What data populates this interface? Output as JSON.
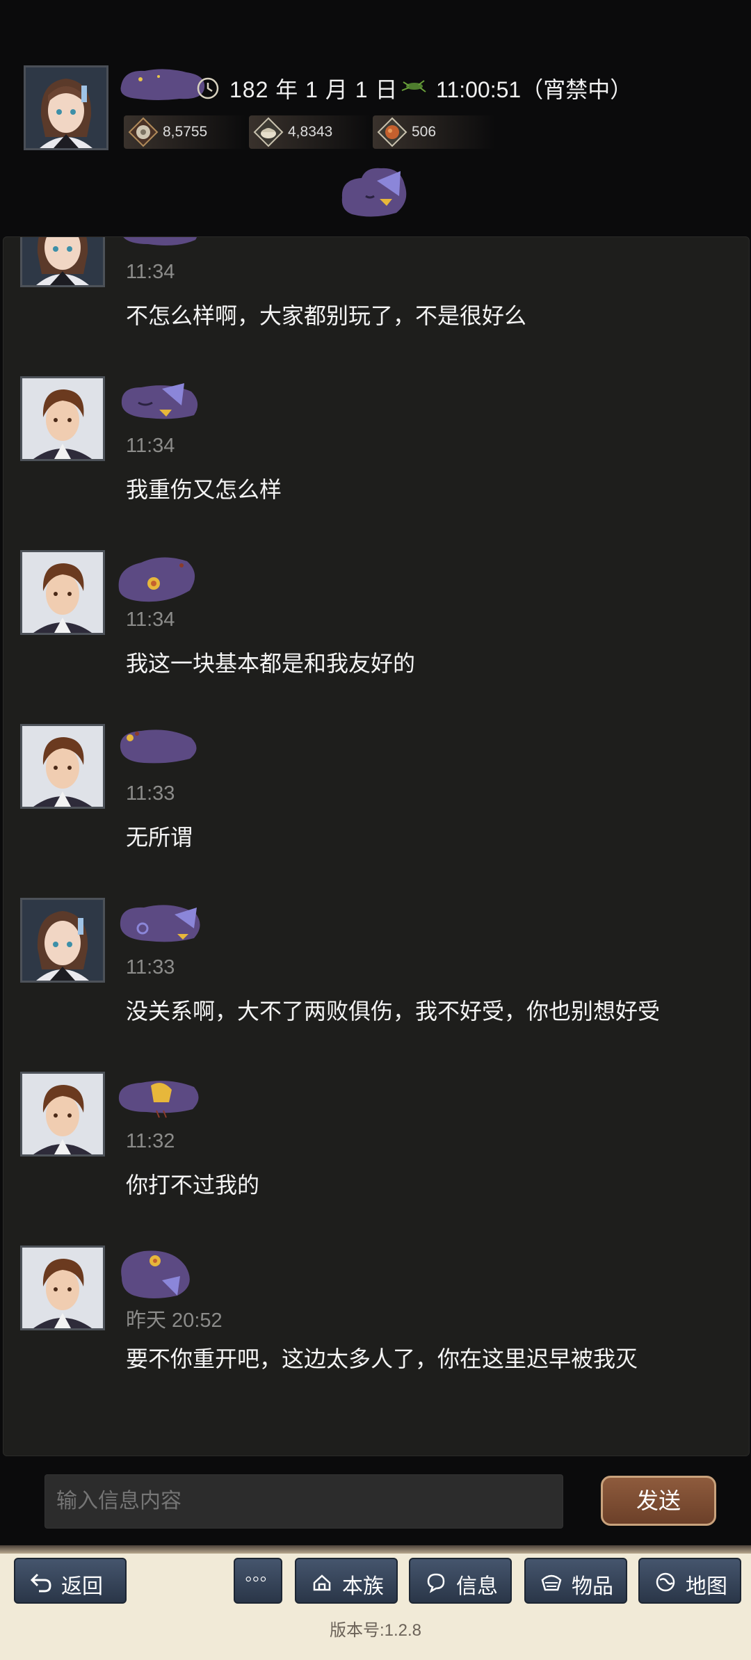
{
  "header": {
    "date": "182 年 1 月 1 日",
    "time": "11:00:51（宵禁中）",
    "resources": [
      {
        "icon": "coin-icon",
        "value": "8,5755"
      },
      {
        "icon": "grain-icon",
        "value": "4,8343"
      },
      {
        "icon": "meat-icon",
        "value": "506"
      }
    ]
  },
  "messages": [
    {
      "avatar": "female",
      "time": "11:34",
      "text": "不怎么样啊，大家都别玩了，不是很好么"
    },
    {
      "avatar": "male",
      "time": "11:34",
      "text": "我重伤又怎么样"
    },
    {
      "avatar": "male",
      "time": "11:34",
      "text": "我这一块基本都是和我友好的"
    },
    {
      "avatar": "male",
      "time": "11:33",
      "text": "无所谓"
    },
    {
      "avatar": "female",
      "time": "11:33",
      "text": "没关系啊，大不了两败俱伤，我不好受，你也别想好受"
    },
    {
      "avatar": "male",
      "time": "11:32",
      "text": "你打不过我的"
    },
    {
      "avatar": "male",
      "time": "昨天 20:52",
      "text": "要不你重开吧，这边太多人了，你在这里迟早被我灭"
    }
  ],
  "input": {
    "placeholder": "输入信息内容"
  },
  "send_label": "发送",
  "nav": {
    "back": "返回",
    "more": "◦◦◦",
    "clan": "本族",
    "info": "信息",
    "items": "物品",
    "map": "地图"
  },
  "version": "版本号:1.2.8",
  "colors": {
    "accent": "#8e5b3d",
    "nav_button": "#3a4a60",
    "panel": "#1e1e1c",
    "blob": "#5c4a83"
  }
}
